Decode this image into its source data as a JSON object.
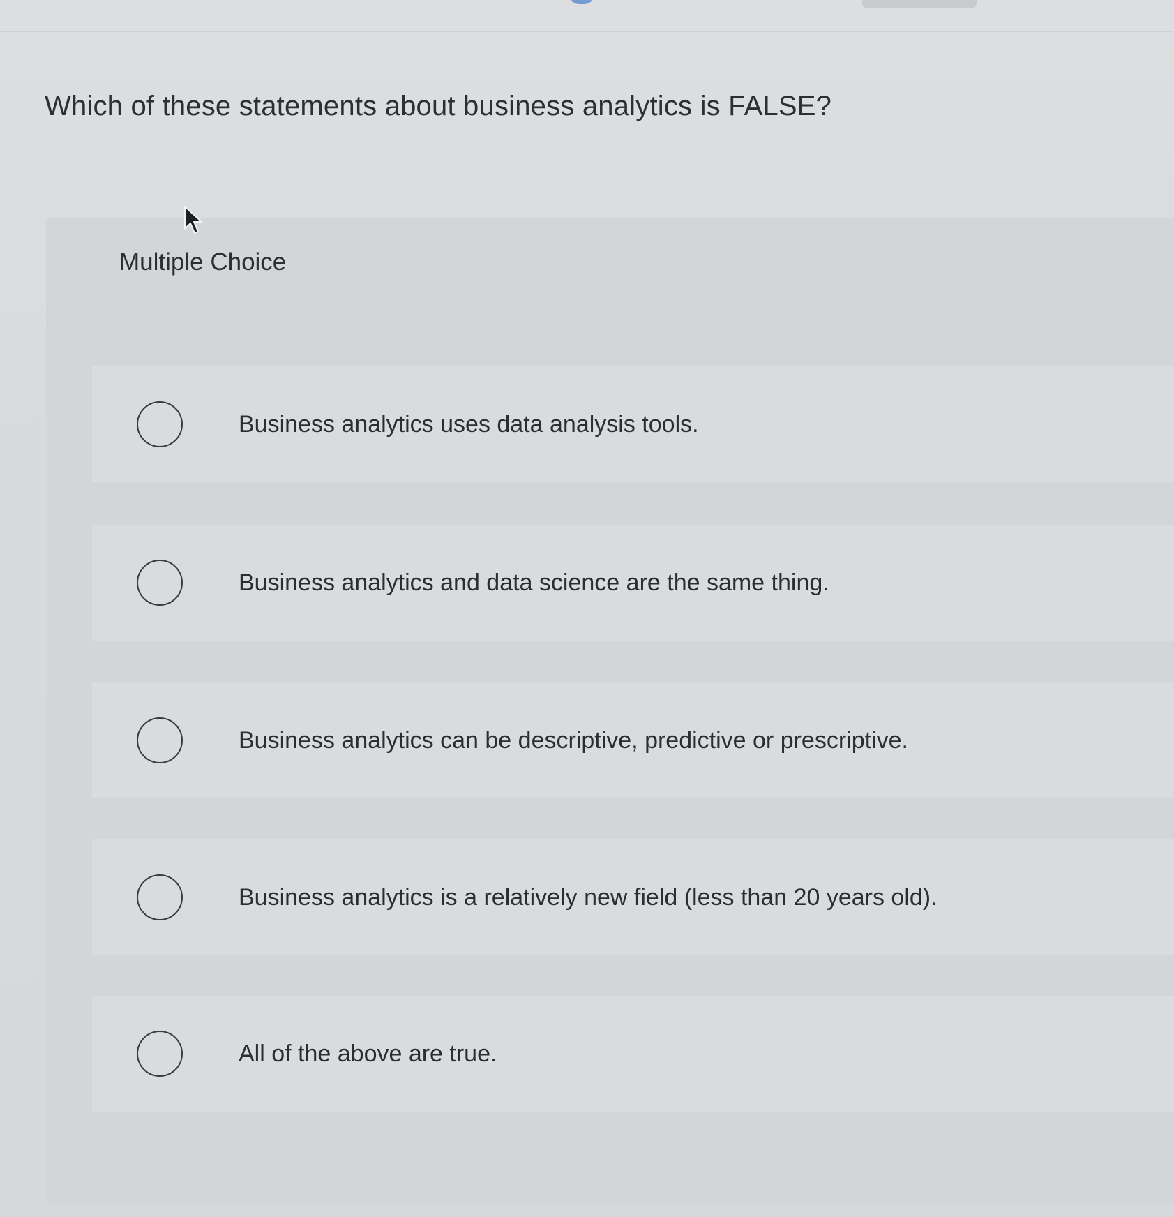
{
  "question": {
    "text": "Which of these statements about business analytics is FALSE?"
  },
  "panel": {
    "type_label": "Multiple Choice"
  },
  "options": [
    {
      "label": "Business analytics uses data analysis tools.",
      "selected": false
    },
    {
      "label": "Business analytics and data science are the same thing.",
      "selected": false
    },
    {
      "label": "Business analytics can be descriptive, predictive or prescriptive.",
      "selected": false
    },
    {
      "label": "Business analytics is a relatively new field (less than 20 years old).",
      "selected": false
    },
    {
      "label": "All of the above are true.",
      "selected": false
    }
  ],
  "icons": {
    "radio": "radio-unselected-icon",
    "cursor": "mouse-pointer-icon"
  }
}
